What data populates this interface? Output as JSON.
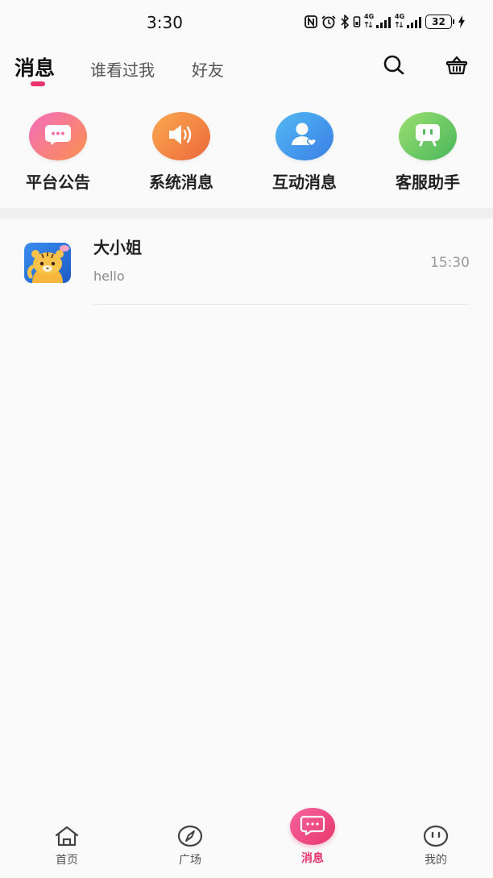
{
  "status_bar": {
    "time": "3:30",
    "icons": [
      "nfc-icon",
      "alarm-icon",
      "bluetooth-icon",
      "vibrate-icon",
      "signal-icon",
      "signal-icon",
      "battery-icon",
      "charging-icon"
    ],
    "network_1": "4G",
    "network_2": "4G",
    "battery": "32"
  },
  "header": {
    "tabs": [
      {
        "label": "消息",
        "active": true
      },
      {
        "label": "谁看过我",
        "active": false
      },
      {
        "label": "好友",
        "active": false
      }
    ],
    "actions": [
      {
        "icon": "search-icon"
      },
      {
        "icon": "basket-icon"
      }
    ]
  },
  "quick_actions": [
    {
      "label": "平台公告",
      "icon": "chat-bubble-icon",
      "color_start": "#f46cbd",
      "color_end": "#f9924f"
    },
    {
      "label": "系统消息",
      "icon": "speaker-icon",
      "color_start": "#f9a94f",
      "color_end": "#ee683b"
    },
    {
      "label": "互动消息",
      "icon": "user-heart-icon",
      "color_start": "#52b9f3",
      "color_end": "#3a7fe6"
    },
    {
      "label": "客服助手",
      "icon": "service-bot-icon",
      "color_start": "#9bdf6f",
      "color_end": "#48b75b"
    }
  ],
  "conversations": [
    {
      "name": "大小姐",
      "last_message": "hello",
      "time": "15:30",
      "avatar": "tiger-avatar"
    }
  ],
  "bottom_nav": [
    {
      "label": "首页",
      "icon": "home-icon",
      "active": false
    },
    {
      "label": "广场",
      "icon": "compass-icon",
      "active": false
    },
    {
      "label": "消息",
      "icon": "message-icon",
      "active": true
    },
    {
      "label": "我的",
      "icon": "smiley-icon",
      "active": false
    }
  ],
  "theme": {
    "accent": "#e8336d",
    "active_nav_start": "#f6649f",
    "active_nav_end": "#e6386c",
    "background": "#fafafa"
  }
}
